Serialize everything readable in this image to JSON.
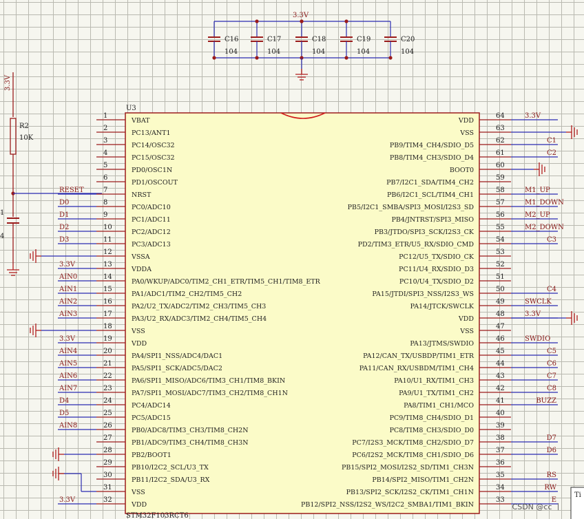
{
  "colors": {
    "wire": "#2b2bb0",
    "component": "#9b1b1b",
    "chip_fill": "#fbfbc8",
    "power": "#b01c1c"
  },
  "capacitor_bank": {
    "net": "3.3V",
    "caps": [
      {
        "ref": "C16",
        "value": "104"
      },
      {
        "ref": "C17",
        "value": "104"
      },
      {
        "ref": "C18",
        "value": "104"
      },
      {
        "ref": "C19",
        "value": "104"
      },
      {
        "ref": "C20",
        "value": "104"
      }
    ]
  },
  "reset_circuit": {
    "power_label": "3.3V",
    "resistor_ref": "R2",
    "resistor_value": "10K",
    "cap_ref": "1",
    "cap_value": "4"
  },
  "chip": {
    "ref": "U3",
    "part": "STM32F103RCT6"
  },
  "left_pins": [
    {
      "num": "1",
      "name": "VBAT",
      "net": ""
    },
    {
      "num": "2",
      "name": "PC13/ANT1",
      "net": ""
    },
    {
      "num": "3",
      "name": "PC14/OSC32",
      "net": ""
    },
    {
      "num": "4",
      "name": "PC15/OSC32",
      "net": ""
    },
    {
      "num": "5",
      "name": "PD0/OSC1N",
      "net": ""
    },
    {
      "num": "6",
      "name": "PD1/OSCOUT",
      "net": ""
    },
    {
      "num": "7",
      "name": "NRST",
      "net": "RESET"
    },
    {
      "num": "8",
      "name": "PC0/ADC10",
      "net": "D0"
    },
    {
      "num": "9",
      "name": "PC1/ADC11",
      "net": "D1"
    },
    {
      "num": "10",
      "name": "PC2/ADC12",
      "net": "D2"
    },
    {
      "num": "11",
      "name": "PC3/ADC13",
      "net": "D3"
    },
    {
      "num": "12",
      "name": "VSSA",
      "net": ""
    },
    {
      "num": "13",
      "name": "VDDA",
      "net": "3.3V"
    },
    {
      "num": "14",
      "name": "PA0/WKUP/ADC0/TIM2_CH1_ETR/TIM5_CH1/TIM8_ETR",
      "net": "AIN0"
    },
    {
      "num": "15",
      "name": "PA1/ADC1/TIM2_CH2/TIM5_CH2",
      "net": "AIN1"
    },
    {
      "num": "16",
      "name": "PA2/U2_TX/ADC2/TIM2_CH3/TIM5_CH3",
      "net": "AIN2"
    },
    {
      "num": "17",
      "name": "PA3/U2_RX/ADC3/TIM2_CH4/TIM5_CH4",
      "net": "AIN3"
    },
    {
      "num": "18",
      "name": "VSS",
      "net": ""
    },
    {
      "num": "19",
      "name": "VDD",
      "net": "3.3V"
    },
    {
      "num": "20",
      "name": "PA4/SPI1_NSS/ADC4/DAC1",
      "net": "AIN4"
    },
    {
      "num": "21",
      "name": "PA5/SPI1_SCK/ADC5/DAC2",
      "net": "AIN5"
    },
    {
      "num": "22",
      "name": "PA6/SPI1_MISO/ADC6/TIM3_CH1/TIM8_BKIN",
      "net": "AIN6"
    },
    {
      "num": "23",
      "name": "PA7/SPI1_MOSI/ADC7/TIM3_CH2/TIM8_CH1N",
      "net": "AIN7"
    },
    {
      "num": "24",
      "name": "PC4/ADC14",
      "net": "D4"
    },
    {
      "num": "25",
      "name": "PC5/ADC15",
      "net": "D5"
    },
    {
      "num": "26",
      "name": "PB0/ADC8/TIM3_CH3/TIM8_CH2N",
      "net": "AIN8"
    },
    {
      "num": "27",
      "name": "PB1/ADC9/TIM3_CH4/TIM8_CH3N",
      "net": ""
    },
    {
      "num": "28",
      "name": "PB2/BOOT1",
      "net": ""
    },
    {
      "num": "29",
      "name": "PB10/I2C2_SCL/U3_TX",
      "net": ""
    },
    {
      "num": "30",
      "name": "PB11/I2C2_SDA/U3_RX",
      "net": ""
    },
    {
      "num": "31",
      "name": "VSS",
      "net": ""
    },
    {
      "num": "32",
      "name": "VDD",
      "net": "3.3V"
    }
  ],
  "right_pins": [
    {
      "num": "64",
      "name": "VDD",
      "net": "3.3V"
    },
    {
      "num": "63",
      "name": "VSS",
      "net": ""
    },
    {
      "num": "62",
      "name": "PB9/TIM4_CH4/SDIO_D5",
      "net": "C1"
    },
    {
      "num": "61",
      "name": "PB8/TIM4_CH3/SDIO_D4",
      "net": "C2"
    },
    {
      "num": "60",
      "name": "BOOT0",
      "net": ""
    },
    {
      "num": "59",
      "name": "PB7/I2C1_SDA/TIM4_CH2",
      "net": ""
    },
    {
      "num": "58",
      "name": "PB6/I2C1_SCL/TIM4_CH1",
      "net": "M1_UP"
    },
    {
      "num": "57",
      "name": "PB5/I2C1_SMBA/SPI3_MOSI/I2S3_SD",
      "net": "M1_DOWN"
    },
    {
      "num": "56",
      "name": "PB4/JNTRST/SPI3_MISO",
      "net": "M2_UP"
    },
    {
      "num": "55",
      "name": "PB3/JTDO/SPI3_SCK/I2S3_CK",
      "net": "M2_DOWN"
    },
    {
      "num": "54",
      "name": "PD2/TIM3_ETR/U5_RX/SDIO_CMD",
      "net": "C3"
    },
    {
      "num": "53",
      "name": "PC12/U5_TX/SDIO_CK",
      "net": ""
    },
    {
      "num": "52",
      "name": "PC11/U4_RX/SDIO_D3",
      "net": ""
    },
    {
      "num": "51",
      "name": "PC10/U4_TX/SDIO_D2",
      "net": ""
    },
    {
      "num": "50",
      "name": "PA15/JTDI/SPI3_NSS/I2S3_WS",
      "net": "C4"
    },
    {
      "num": "49",
      "name": "PA14/JTCK/SWCLK",
      "net": "SWCLK"
    },
    {
      "num": "48",
      "name": "VDD",
      "net": "3.3V"
    },
    {
      "num": "47",
      "name": "VSS",
      "net": ""
    },
    {
      "num": "46",
      "name": "PA13/JTMS/SWDIO",
      "net": "SWDIO"
    },
    {
      "num": "45",
      "name": "PA12/CAN_TX/USBDP/TIM1_ETR",
      "net": "C5"
    },
    {
      "num": "44",
      "name": "PA11/CAN_RX/USBDM/TIM1_CH4",
      "net": "C6"
    },
    {
      "num": "43",
      "name": "PA10/U1_RX/TIM1_CH3",
      "net": "C7"
    },
    {
      "num": "42",
      "name": "PA9/U1_TX/TIM1_CH2",
      "net": "C8"
    },
    {
      "num": "41",
      "name": "PA8/TIM1_CH1/MCO",
      "net": "BUZZ"
    },
    {
      "num": "40",
      "name": "PC9/TIM8_CH4/SDIO_D1",
      "net": ""
    },
    {
      "num": "39",
      "name": "PC8/TIM8_CH3/SDIO_D0",
      "net": ""
    },
    {
      "num": "38",
      "name": "PC7/I2S3_MCK/TIM8_CH2/SDIO_D7",
      "net": "D7"
    },
    {
      "num": "37",
      "name": "PC6/I2S2_MCK/TIM8_CH1/SDIO_D6",
      "net": "D6"
    },
    {
      "num": "36",
      "name": "PB15/SPI2_MOSI/I2S2_SD/TIM1_CH3N",
      "net": ""
    },
    {
      "num": "35",
      "name": "PB14/SPI2_MISO/TIM1_CH2N",
      "net": "RS"
    },
    {
      "num": "34",
      "name": "PB13/SPI2_SCK/I2S2_CK/TIM1_CH1N",
      "net": "RW"
    },
    {
      "num": "33",
      "name": "PB12/SPI2_NSS/I2S2_WS/I2C2_SMBA1/TIM1_BKIN",
      "net": "E"
    }
  ],
  "corner_label": "Ti",
  "watermark": "CSDN @cc 丨"
}
